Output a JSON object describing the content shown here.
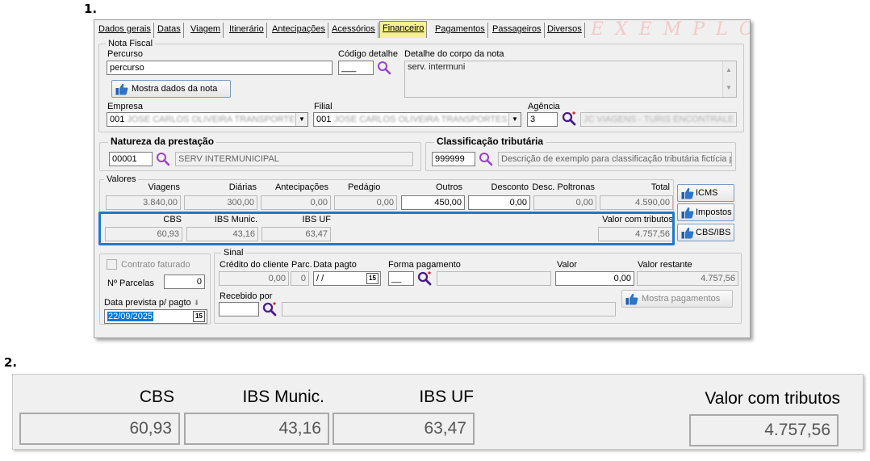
{
  "steps": {
    "one": "1.",
    "two": "2."
  },
  "tabs": [
    {
      "label": "Dados gerais"
    },
    {
      "label": "Datas"
    },
    {
      "label": "Viagem"
    },
    {
      "label": "Itinerário"
    },
    {
      "label": "Antecipações"
    },
    {
      "label": "Acessórios"
    },
    {
      "label": "Financeiro",
      "active": true
    },
    {
      "label": "Pagamentos"
    },
    {
      "label": "Passageiros"
    },
    {
      "label": "Diversos"
    }
  ],
  "watermark": "EXEMPLO",
  "nota_fiscal": {
    "title": "Nota Fiscal",
    "percurso_label": "Percurso",
    "percurso_value": "percurso",
    "codigo_detalhe_label": "Código detalhe",
    "codigo_detalhe_value": "___",
    "detalhe_corpo_label": "Detalhe do corpo da nota",
    "detalhe_corpo_value": "serv. intermuni",
    "mostra_dados_button": "Mostra dados da nota",
    "empresa_label": "Empresa",
    "empresa_code": "001",
    "empresa_name": "JOSE CARLOS OLIVEIRA TRANSPORTES",
    "filial_label": "Filial",
    "filial_code": "001",
    "filial_name": "JOSE CARLOS OLIVEIRA TRANSPORTES",
    "agencia_label": "Agência",
    "agencia_value": "3",
    "agencia_name": "JC VIAGENS - TURIS ENCONTRALE"
  },
  "natureza": {
    "title": "Natureza da prestação",
    "code": "00001",
    "desc": "SERV INTERMUNICIPAL"
  },
  "classificacao": {
    "title": "Classificação tributária",
    "code": "999999",
    "desc": "Descrição de exemplo para classificação tributária fictícia pa"
  },
  "valores": {
    "title": "Valores",
    "headers": [
      "Viagens",
      "Diárias",
      "Antecipações",
      "Pedágio",
      "Outros",
      "Desconto",
      "Desc. Poltronas",
      "Total"
    ],
    "values": [
      "3.840,00",
      "300,00",
      "0,00",
      "0,00",
      "450,00",
      "0,00",
      "0,00",
      "4.590,00"
    ],
    "cbs_label": "CBS",
    "cbs_value": "60,93",
    "ibs_munic_label": "IBS Munic.",
    "ibs_munic_value": "43,16",
    "ibs_uf_label": "IBS UF",
    "ibs_uf_value": "63,47",
    "valor_tributos_label": "Valor com tributos",
    "valor_tributos_value": "4.757,56",
    "icms_button": "ICMS",
    "impostos_button": "Impostos",
    "cbs_ibs_button": "CBS/IBS"
  },
  "left_panel": {
    "contrato_label": "Contrato faturado",
    "parcelas_label": "Nº Parcelas",
    "parcelas_value": "0",
    "data_prevista_label": "Data prevista p/ pagto",
    "data_prevista_value": "22/09/2025"
  },
  "sinal": {
    "title": "Sinal",
    "credito_label": "Crédito do cliente",
    "credito_value": "0,00",
    "parc_label": "Parc.",
    "parc_value": "0",
    "data_pagto_label": "Data pagto",
    "data_pagto_value": "/ /",
    "forma_label": "Forma pagamento",
    "forma_value": "__",
    "valor_label": "Valor",
    "valor_value": "0,00",
    "valor_restante_label": "Valor restante",
    "valor_restante_value": "4.757,56",
    "recebido_label": "Recebido por",
    "mostra_pagamentos_button": "Mostra pagamentos"
  },
  "zoom": {
    "cbs_label": "CBS",
    "cbs_value": "60,93",
    "ibs_munic_label": "IBS Munic.",
    "ibs_munic_value": "43,16",
    "ibs_uf_label": "IBS UF",
    "ibs_uf_value": "63,47",
    "valor_tributos_label": "Valor com tributos",
    "valor_tributos_value": "4.757,56"
  },
  "colors": {
    "highlight": "#1f78d1",
    "active_tab": "#f6f090",
    "selection": "#0078d7",
    "icon_blue": "#1a5fb4",
    "magnifier": "#8a2be2"
  }
}
